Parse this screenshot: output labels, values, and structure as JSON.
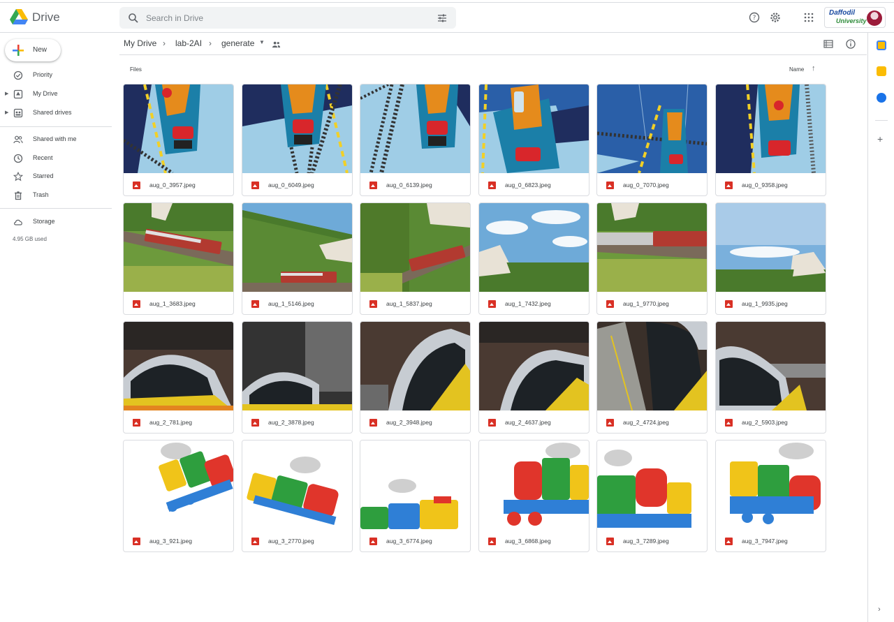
{
  "app": {
    "brand": "Drive"
  },
  "search": {
    "placeholder": "Search in Drive"
  },
  "org": {
    "line1": "Daffodil",
    "line2": "University"
  },
  "sidebar": {
    "new_label": "New",
    "items": [
      {
        "label": "Priority",
        "icon": "priority-icon"
      },
      {
        "label": "My Drive",
        "icon": "my-drive-icon"
      },
      {
        "label": "Shared drives",
        "icon": "shared-drives-icon"
      },
      {
        "label": "Shared with me",
        "icon": "shared-with-me-icon"
      },
      {
        "label": "Recent",
        "icon": "recent-icon"
      },
      {
        "label": "Starred",
        "icon": "star-icon"
      },
      {
        "label": "Trash",
        "icon": "trash-icon"
      },
      {
        "label": "Storage",
        "icon": "cloud-icon"
      }
    ],
    "storage_used": "4.95 GB used"
  },
  "breadcrumbs": [
    "My Drive",
    "lab-2AI",
    "generate"
  ],
  "section": {
    "files_label": "Files",
    "sort_label": "Name"
  },
  "files": [
    {
      "name": "aug_0_3957.jpeg",
      "theme": "toy-blue"
    },
    {
      "name": "aug_0_6049.jpeg",
      "theme": "toy-blue"
    },
    {
      "name": "aug_0_6139.jpeg",
      "theme": "toy-blue"
    },
    {
      "name": "aug_0_6823.jpeg",
      "theme": "toy-blue"
    },
    {
      "name": "aug_0_7070.jpeg",
      "theme": "toy-blue"
    },
    {
      "name": "aug_0_9358.jpeg",
      "theme": "toy-blue"
    },
    {
      "name": "aug_1_3683.jpeg",
      "theme": "landscape"
    },
    {
      "name": "aug_1_5146.jpeg",
      "theme": "landscape"
    },
    {
      "name": "aug_1_5837.jpeg",
      "theme": "landscape"
    },
    {
      "name": "aug_1_7432.jpeg",
      "theme": "sky"
    },
    {
      "name": "aug_1_9770.jpeg",
      "theme": "landscape"
    },
    {
      "name": "aug_1_9935.jpeg",
      "theme": "sky"
    },
    {
      "name": "aug_2_781.jpeg",
      "theme": "station"
    },
    {
      "name": "aug_2_3878.jpeg",
      "theme": "station"
    },
    {
      "name": "aug_2_3948.jpeg",
      "theme": "station"
    },
    {
      "name": "aug_2_4637.jpeg",
      "theme": "station"
    },
    {
      "name": "aug_2_4724.jpeg",
      "theme": "station"
    },
    {
      "name": "aug_2_5903.jpeg",
      "theme": "station"
    },
    {
      "name": "aug_3_921.jpeg",
      "theme": "cartoon"
    },
    {
      "name": "aug_3_2770.jpeg",
      "theme": "cartoon"
    },
    {
      "name": "aug_3_6774.jpeg",
      "theme": "cartoon"
    },
    {
      "name": "aug_3_6868.jpeg",
      "theme": "cartoon"
    },
    {
      "name": "aug_3_7289.jpeg",
      "theme": "cartoon"
    },
    {
      "name": "aug_3_7947.jpeg",
      "theme": "cartoon"
    }
  ]
}
